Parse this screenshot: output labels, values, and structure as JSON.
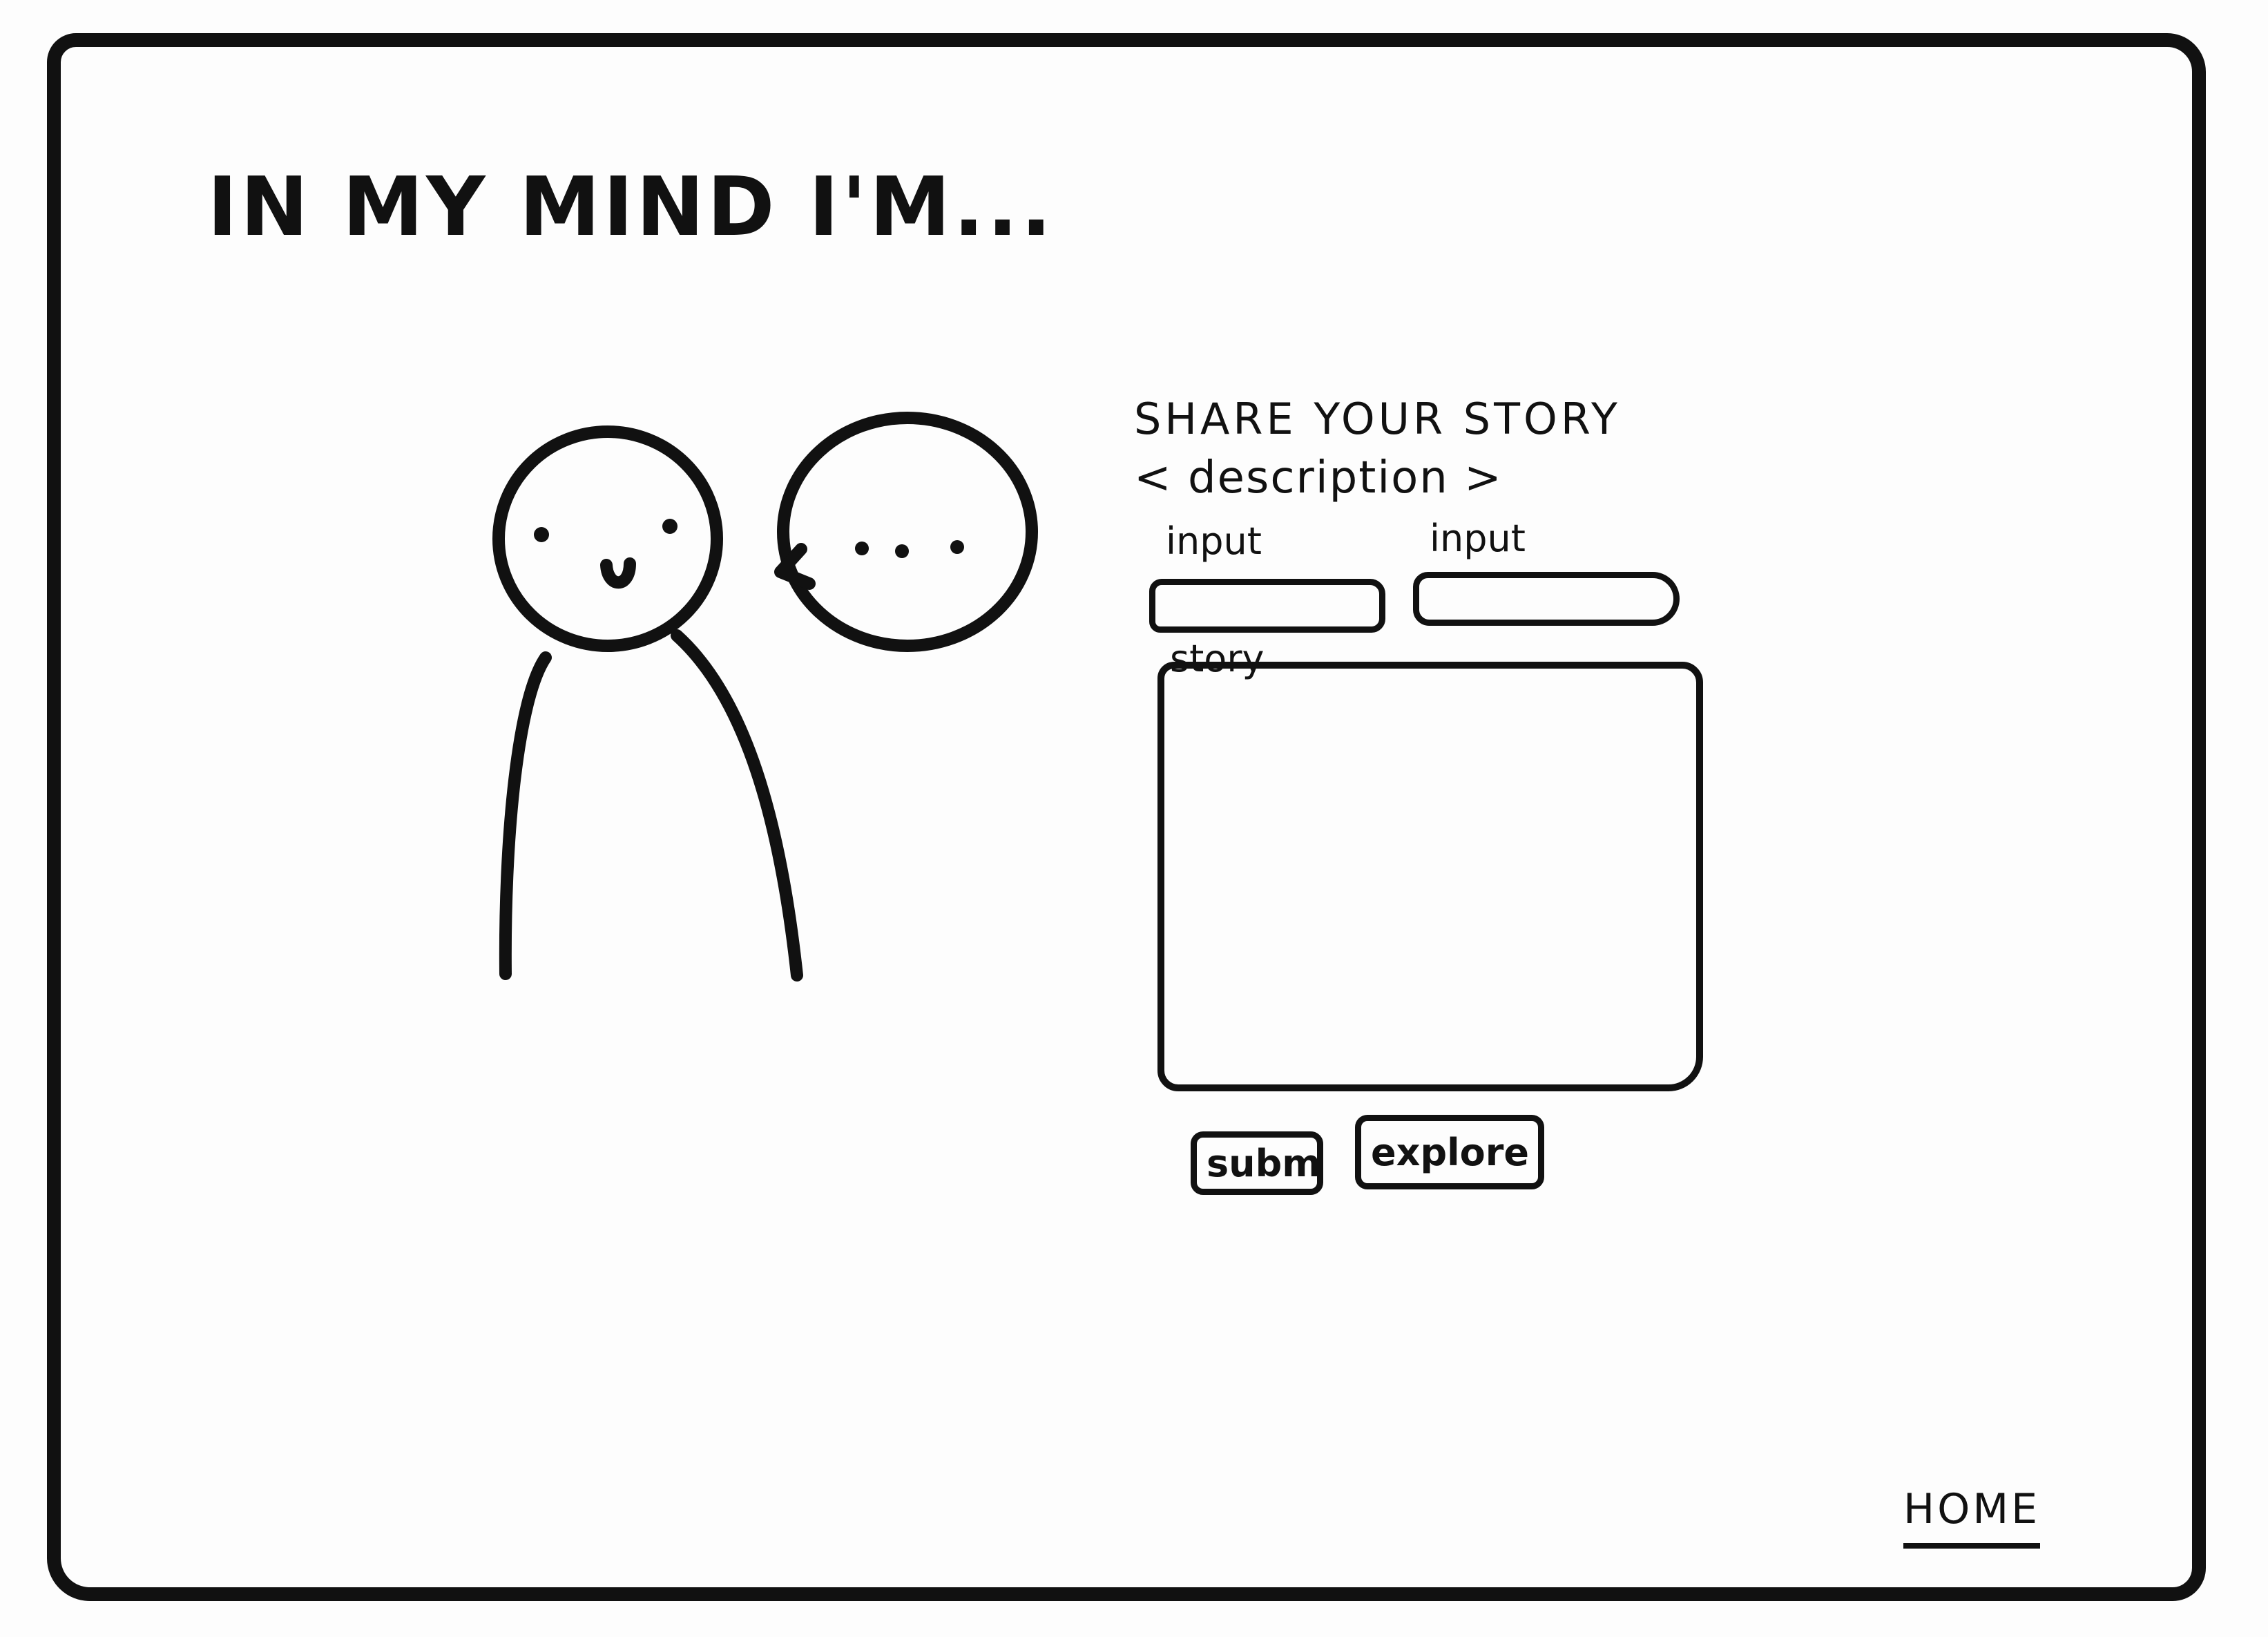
{
  "header": {
    "title": "IN MY MIND I'M..."
  },
  "form": {
    "heading": "SHARE YOUR STORY",
    "description": "< description >",
    "input_1_label": "input",
    "input_2_label": "input",
    "story_label": "story",
    "submit_label": "submi",
    "explore_label": "explore"
  },
  "nav": {
    "home_label": "HOME"
  },
  "illustration": {
    "thought_bubble_text": "• • •"
  },
  "colors": {
    "ink": "#111111",
    "paper": "#fdfdfd"
  }
}
